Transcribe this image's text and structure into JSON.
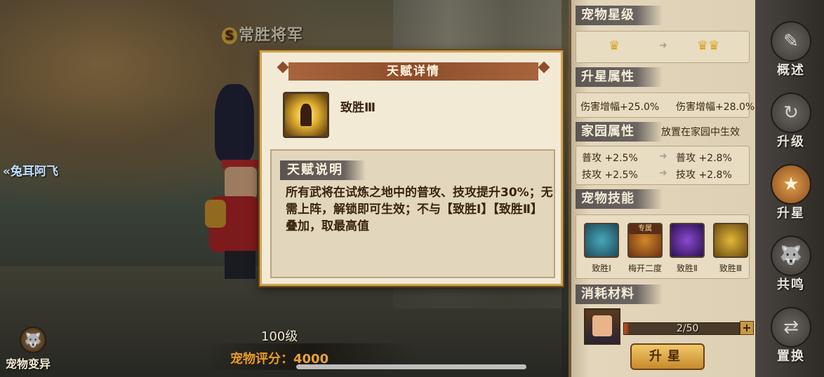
{
  "title": {
    "rank": "S",
    "name": "常胜将军"
  },
  "prev_pet": "兔耳阿飞",
  "level": "100级",
  "score": {
    "label": "宠物评分：",
    "value": "4000"
  },
  "mutate": {
    "label": "宠物变异",
    "icon": "wolf-icon"
  },
  "right_panel": {
    "star_level": {
      "title": "宠物星级",
      "from_crowns": "♛",
      "to_crowns": "♛♛",
      "arrow": "➜"
    },
    "upgrade_attr": {
      "title": "升星属性",
      "from": "伤害增幅+25.0%",
      "to": "伤害增幅+28.0%"
    },
    "home_attr": {
      "title": "家园属性",
      "note": "放置在家园中生效",
      "rows": [
        {
          "from": "普攻 +2.5%",
          "to": "普攻 +2.8%"
        },
        {
          "from": "技攻 +2.5%",
          "to": "技攻 +2.8%"
        }
      ]
    },
    "pet_skills": {
      "title": "宠物技能",
      "items": [
        {
          "label": "致胜Ⅰ",
          "tag": ""
        },
        {
          "label": "梅开二度",
          "tag": "专属"
        },
        {
          "label": "致胜Ⅱ",
          "tag": ""
        },
        {
          "label": "致胜Ⅲ",
          "tag": ""
        }
      ]
    },
    "materials": {
      "title": "消耗材料",
      "count": "2/50",
      "progress": 0.04,
      "plus": "+"
    },
    "starup_button": "升星"
  },
  "tabs": [
    {
      "label": "概述",
      "icon": "scroll-icon"
    },
    {
      "label": "升级",
      "icon": "swirl-icon"
    },
    {
      "label": "升星",
      "icon": "star-icon"
    },
    {
      "label": "共鸣",
      "icon": "wolf-icon"
    },
    {
      "label": "置换",
      "icon": "swap-icon"
    }
  ],
  "modal": {
    "title": "天赋详情",
    "talent_name": "致胜Ⅲ",
    "desc_title": "天赋说明",
    "desc_text": "所有武将在试炼之地中的普攻、技攻提升30%；无需上阵，解锁即可生效；不与【致胜Ⅰ】【致胜Ⅱ】叠加，取最高值"
  },
  "colors": {
    "accent": "#8e4e2c",
    "gold": "#cfa452",
    "score": "#e6a23c"
  }
}
